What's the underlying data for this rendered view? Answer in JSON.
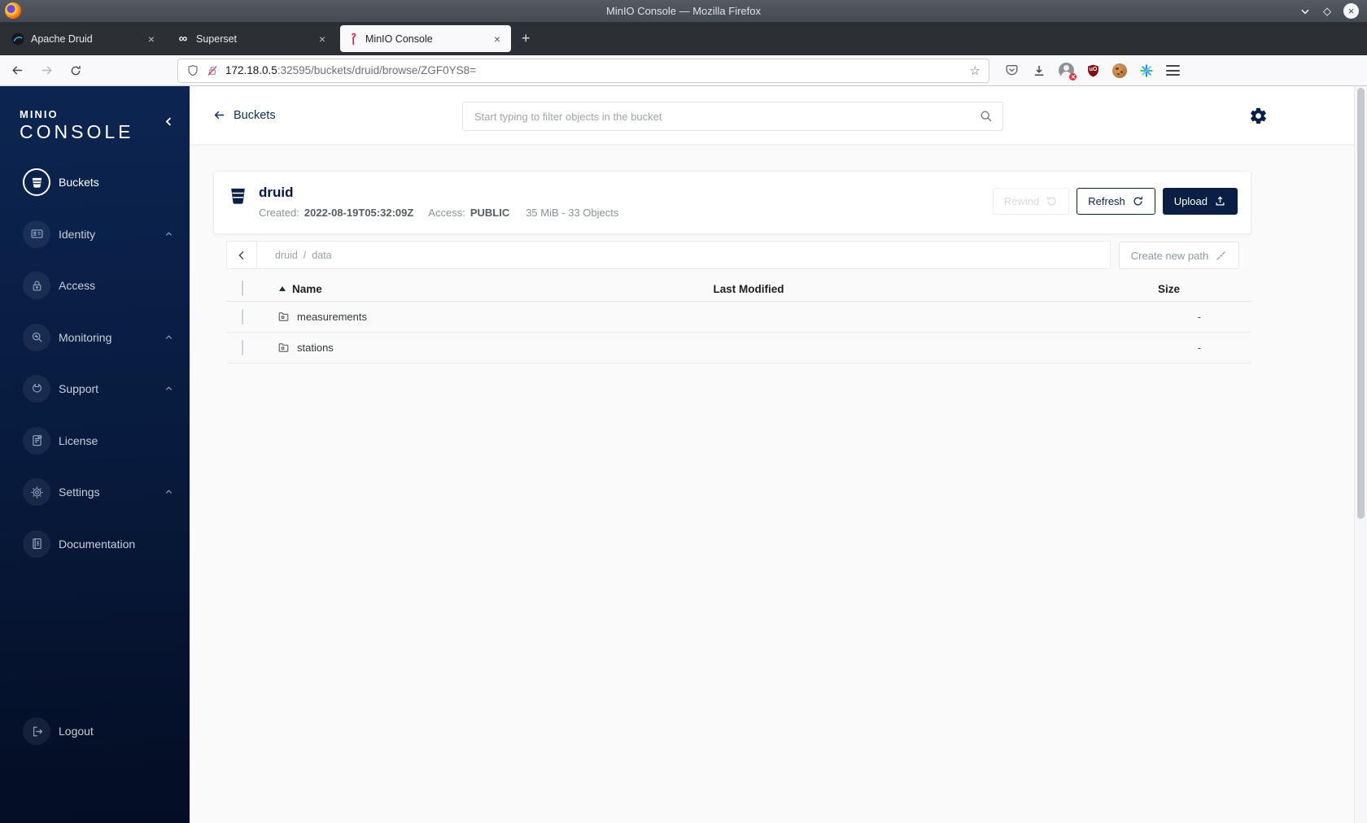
{
  "titlebar": {
    "title": "MinIO Console — Mozilla Firefox"
  },
  "tabs": [
    {
      "label": "Apache Druid"
    },
    {
      "label": "Superset"
    },
    {
      "label": "MinIO Console"
    }
  ],
  "urlbar": {
    "host": "172.18.0.5",
    "path": ":32595/buckets/druid/browse/ZGF0YS8="
  },
  "glyphs": {
    "close": "×",
    "new_tab": "+",
    "infinity": "∞",
    "diamond": "◇",
    "star": "☆",
    "ublock": "uO"
  },
  "sidebar": {
    "logo_line1": "MINIO",
    "logo_line2": "CONSOLE",
    "items": [
      {
        "label": "Buckets"
      },
      {
        "label": "Identity"
      },
      {
        "label": "Access"
      },
      {
        "label": "Monitoring"
      },
      {
        "label": "Support"
      },
      {
        "label": "License"
      },
      {
        "label": "Settings"
      },
      {
        "label": "Documentation"
      }
    ],
    "logout": "Logout"
  },
  "header": {
    "back": "Buckets",
    "search_placeholder": "Start typing to filter objects in the bucket"
  },
  "bucket": {
    "name": "druid",
    "created_label": "Created:",
    "created": "2022-08-19T05:32:09Z",
    "access_label": "Access:",
    "access": "PUBLIC",
    "usage": "35 MiB - 33 Objects",
    "rewind": "Rewind",
    "refresh": "Refresh",
    "upload": "Upload"
  },
  "browse": {
    "path_root": "druid",
    "path_sep": "/",
    "path_current": "data",
    "create_new_path": "Create new path"
  },
  "table": {
    "col_name": "Name",
    "col_modified": "Last Modified",
    "col_size": "Size",
    "rows": [
      {
        "name": "measurements",
        "size": "-"
      },
      {
        "name": "stations",
        "size": "-"
      }
    ]
  },
  "colors": {
    "accent": "#081c42",
    "flamingo": "#c72c48"
  }
}
